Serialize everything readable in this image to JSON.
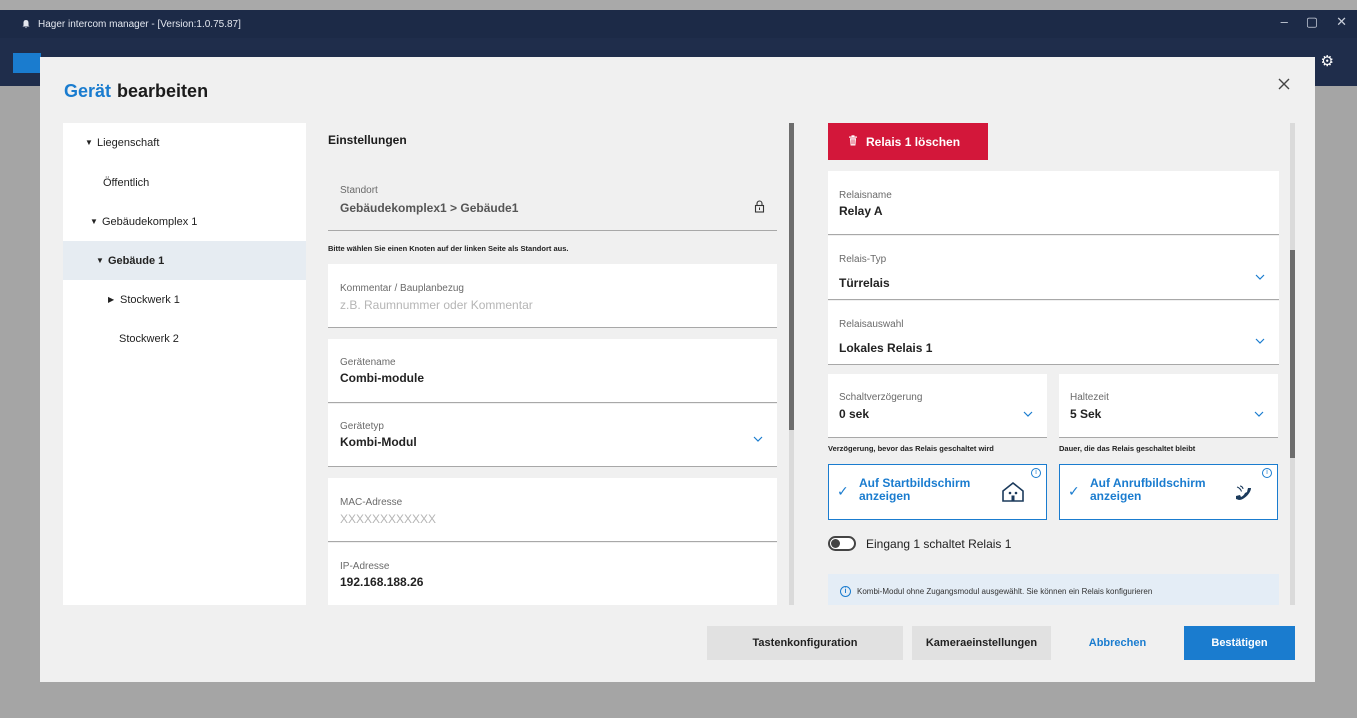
{
  "window": {
    "title": "Hager intercom manager - [Version:1.0.75.87]",
    "controls": [
      "–",
      "▢",
      "✕"
    ]
  },
  "modal": {
    "title_blue": "Gerät",
    "title_black": "bearbeiten"
  },
  "tree": {
    "items": [
      {
        "label": "Liegenschaft",
        "caret": "▼",
        "selected": false
      },
      {
        "label": "Öffentlich",
        "caret": "",
        "selected": false
      },
      {
        "label": "Gebäudekomplex 1",
        "caret": "▼",
        "selected": false
      },
      {
        "label": "Gebäude 1",
        "caret": "▼",
        "selected": true
      },
      {
        "label": "Stockwerk 1",
        "caret": "▶",
        "selected": false
      },
      {
        "label": "Stockwerk 2",
        "caret": "",
        "selected": false
      }
    ]
  },
  "settings": {
    "section_title": "Einstellungen",
    "standort_label": "Standort",
    "standort_value": "Gebäudekomplex1 > Gebäude1",
    "standort_hint": "Bitte wählen Sie einen Knoten auf der linken Seite als Standort aus.",
    "kommentar_label": "Kommentar / Bauplanbezug",
    "kommentar_placeholder": "z.B. Raumnummer oder Kommentar",
    "geraetename_label": "Gerätename",
    "geraetename_value": "Combi-module",
    "geraetetyp_label": "Gerätetyp",
    "geraetetyp_value": "Kombi-Modul",
    "mac_label": "MAC-Adresse",
    "mac_placeholder": "XXXXXXXXXXXX",
    "ip_label": "IP-Adresse",
    "ip_value": "192.168.188.26"
  },
  "relay": {
    "delete_label": "Relais 1 löschen",
    "name_label": "Relaisname",
    "name_value": "Relay A",
    "type_label": "Relais-Typ",
    "type_value": "Türrelais",
    "select_label": "Relaisauswahl",
    "select_value": "Lokales Relais 1",
    "delay_label": "Schaltverzögerung",
    "delay_value": "0 sek",
    "delay_hint": "Verzögerung, bevor das Relais geschaltet wird",
    "hold_label": "Haltezeit",
    "hold_value": "5 Sek",
    "hold_hint": "Dauer, die das Relais geschaltet bleibt",
    "card_home": "Auf Startbildschirm anzeigen",
    "card_call": "Auf Anrufbildschirm anzeigen",
    "switch_label": "Eingang 1 schaltet Relais 1",
    "switch_on": false,
    "info_text": "Kombi-Modul ohne Zugangsmodul ausgewählt. Sie können ein Relais konfigurieren"
  },
  "footer": {
    "keys_button": "Tastenkonfiguration",
    "camera_button": "Kameraeinstellungen",
    "cancel_button": "Abbrechen",
    "confirm_button": "Bestätigen"
  },
  "colors": {
    "accent": "#1a7ccf",
    "danger": "#d3173a",
    "titlebar": "#1c2a47"
  }
}
